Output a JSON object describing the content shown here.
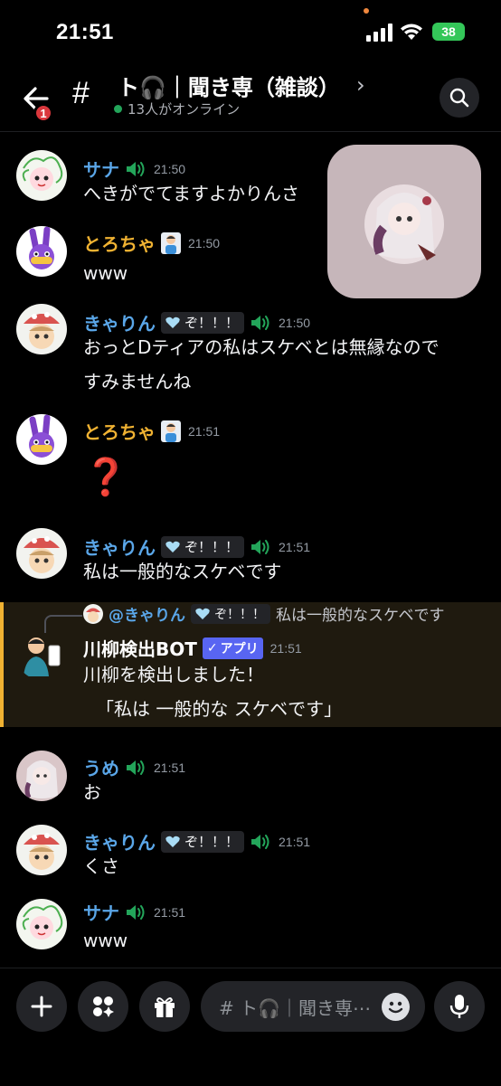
{
  "status": {
    "time": "21:51",
    "battery": "38"
  },
  "header": {
    "back_badge": "1",
    "channel_name": "ト🎧｜聞き専（雑談）",
    "online": "13人がオンライン"
  },
  "messages": [
    {
      "user": "サナ",
      "time": "21:50",
      "text": "へきがでてますよかりんさ"
    },
    {
      "user": "とろちゃ",
      "time": "21:50",
      "text": "www"
    },
    {
      "user": "きゃりん",
      "tag": "ぞ！！！",
      "time": "21:50",
      "lines": [
        "おっとDティアの私はスケベとは無縁なので",
        "すみませんね"
      ]
    },
    {
      "user": "とろちゃ",
      "time": "21:51",
      "text": "❓"
    },
    {
      "user": "きゃりん",
      "tag": "ぞ！！！",
      "time": "21:51",
      "text": "私は一般的なスケベです"
    },
    {
      "user": "うめ",
      "time": "21:51",
      "text": "お"
    },
    {
      "user": "きゃりん",
      "tag": "ぞ！！！",
      "time": "21:51",
      "text": "くさ"
    },
    {
      "user": "サナ",
      "time": "21:51",
      "text": "www"
    }
  ],
  "bot": {
    "reply_user": "@きゃりん",
    "reply_tag": "ぞ！！！",
    "reply_text": "私は一般的なスケベです",
    "name": "川柳検出BOT",
    "badge": "アプリ",
    "time": "21:51",
    "line1": "川柳を検出しました！",
    "line2": "「私は 一般的な スケベです」"
  },
  "composer": {
    "placeholder": "# ト🎧｜聞き専⋯"
  },
  "colors": {
    "accent_blue": "#5aa6e8",
    "accent_orange": "#f0b232",
    "online_green": "#23a55a",
    "badge_red": "#da373c",
    "app_badge": "#5865f2"
  }
}
